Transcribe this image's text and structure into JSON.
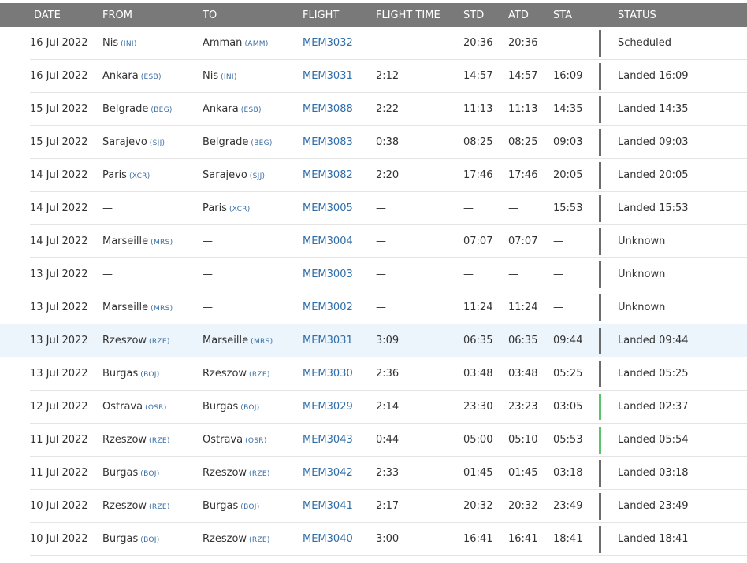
{
  "columns": {
    "date": "DATE",
    "from": "FROM",
    "to": "TO",
    "flight": "FLIGHT",
    "flight_time": "FLIGHT TIME",
    "std": "STD",
    "atd": "ATD",
    "sta": "STA",
    "status": "STATUS"
  },
  "colors": {
    "header_bg": "#797979",
    "link": "#2f6da8",
    "highlight_row": "#edf5fc",
    "status_bar_default": "#6b6b6b",
    "status_bar_ontime": "#5dc26b"
  },
  "rows": [
    {
      "date": "16 Jul 2022",
      "from": {
        "city": "Nis",
        "code": "(INI)"
      },
      "to": {
        "city": "Amman",
        "code": "(AMM)"
      },
      "flight": "MEM3032",
      "flight_time": "—",
      "std": "20:36",
      "atd": "20:36",
      "sta": "—",
      "status": "Scheduled",
      "bar": "default",
      "highlight": false
    },
    {
      "date": "16 Jul 2022",
      "from": {
        "city": "Ankara",
        "code": "(ESB)"
      },
      "to": {
        "city": "Nis",
        "code": "(INI)"
      },
      "flight": "MEM3031",
      "flight_time": "2:12",
      "std": "14:57",
      "atd": "14:57",
      "sta": "16:09",
      "status": "Landed 16:09",
      "bar": "default",
      "highlight": false
    },
    {
      "date": "15 Jul 2022",
      "from": {
        "city": "Belgrade",
        "code": "(BEG)"
      },
      "to": {
        "city": "Ankara",
        "code": "(ESB)"
      },
      "flight": "MEM3088",
      "flight_time": "2:22",
      "std": "11:13",
      "atd": "11:13",
      "sta": "14:35",
      "status": "Landed 14:35",
      "bar": "default",
      "highlight": false
    },
    {
      "date": "15 Jul 2022",
      "from": {
        "city": "Sarajevo",
        "code": "(SJJ)"
      },
      "to": {
        "city": "Belgrade",
        "code": "(BEG)"
      },
      "flight": "MEM3083",
      "flight_time": "0:38",
      "std": "08:25",
      "atd": "08:25",
      "sta": "09:03",
      "status": "Landed 09:03",
      "bar": "default",
      "highlight": false
    },
    {
      "date": "14 Jul 2022",
      "from": {
        "city": "Paris",
        "code": "(XCR)"
      },
      "to": {
        "city": "Sarajevo",
        "code": "(SJJ)"
      },
      "flight": "MEM3082",
      "flight_time": "2:20",
      "std": "17:46",
      "atd": "17:46",
      "sta": "20:05",
      "status": "Landed 20:05",
      "bar": "default",
      "highlight": false
    },
    {
      "date": "14 Jul 2022",
      "from": {
        "city": "—",
        "code": ""
      },
      "to": {
        "city": "Paris",
        "code": "(XCR)"
      },
      "flight": "MEM3005",
      "flight_time": "—",
      "std": "—",
      "atd": "—",
      "sta": "15:53",
      "status": "Landed 15:53",
      "bar": "default",
      "highlight": false
    },
    {
      "date": "14 Jul 2022",
      "from": {
        "city": "Marseille",
        "code": "(MRS)"
      },
      "to": {
        "city": "—",
        "code": ""
      },
      "flight": "MEM3004",
      "flight_time": "—",
      "std": "07:07",
      "atd": "07:07",
      "sta": "—",
      "status": "Unknown",
      "bar": "default",
      "highlight": false
    },
    {
      "date": "13 Jul 2022",
      "from": {
        "city": "—",
        "code": ""
      },
      "to": {
        "city": "—",
        "code": ""
      },
      "flight": "MEM3003",
      "flight_time": "—",
      "std": "—",
      "atd": "—",
      "sta": "—",
      "status": "Unknown",
      "bar": "default",
      "highlight": false
    },
    {
      "date": "13 Jul 2022",
      "from": {
        "city": "Marseille",
        "code": "(MRS)"
      },
      "to": {
        "city": "—",
        "code": ""
      },
      "flight": "MEM3002",
      "flight_time": "—",
      "std": "11:24",
      "atd": "11:24",
      "sta": "—",
      "status": "Unknown",
      "bar": "default",
      "highlight": false
    },
    {
      "date": "13 Jul 2022",
      "from": {
        "city": "Rzeszow",
        "code": "(RZE)"
      },
      "to": {
        "city": "Marseille",
        "code": "(MRS)"
      },
      "flight": "MEM3031",
      "flight_time": "3:09",
      "std": "06:35",
      "atd": "06:35",
      "sta": "09:44",
      "status": "Landed 09:44",
      "bar": "default",
      "highlight": true
    },
    {
      "date": "13 Jul 2022",
      "from": {
        "city": "Burgas",
        "code": "(BOJ)"
      },
      "to": {
        "city": "Rzeszow",
        "code": "(RZE)"
      },
      "flight": "MEM3030",
      "flight_time": "2:36",
      "std": "03:48",
      "atd": "03:48",
      "sta": "05:25",
      "status": "Landed 05:25",
      "bar": "default",
      "highlight": false
    },
    {
      "date": "12 Jul 2022",
      "from": {
        "city": "Ostrava",
        "code": "(OSR)"
      },
      "to": {
        "city": "Burgas",
        "code": "(BOJ)"
      },
      "flight": "MEM3029",
      "flight_time": "2:14",
      "std": "23:30",
      "atd": "23:23",
      "sta": "03:05",
      "status": "Landed 02:37",
      "bar": "ontime",
      "highlight": false
    },
    {
      "date": "11 Jul 2022",
      "from": {
        "city": "Rzeszow",
        "code": "(RZE)"
      },
      "to": {
        "city": "Ostrava",
        "code": "(OSR)"
      },
      "flight": "MEM3043",
      "flight_time": "0:44",
      "std": "05:00",
      "atd": "05:10",
      "sta": "05:53",
      "status": "Landed 05:54",
      "bar": "ontime",
      "highlight": false
    },
    {
      "date": "11 Jul 2022",
      "from": {
        "city": "Burgas",
        "code": "(BOJ)"
      },
      "to": {
        "city": "Rzeszow",
        "code": "(RZE)"
      },
      "flight": "MEM3042",
      "flight_time": "2:33",
      "std": "01:45",
      "atd": "01:45",
      "sta": "03:18",
      "status": "Landed 03:18",
      "bar": "default",
      "highlight": false
    },
    {
      "date": "10 Jul 2022",
      "from": {
        "city": "Rzeszow",
        "code": "(RZE)"
      },
      "to": {
        "city": "Burgas",
        "code": "(BOJ)"
      },
      "flight": "MEM3041",
      "flight_time": "2:17",
      "std": "20:32",
      "atd": "20:32",
      "sta": "23:49",
      "status": "Landed 23:49",
      "bar": "default",
      "highlight": false
    },
    {
      "date": "10 Jul 2022",
      "from": {
        "city": "Burgas",
        "code": "(BOJ)"
      },
      "to": {
        "city": "Rzeszow",
        "code": "(RZE)"
      },
      "flight": "MEM3040",
      "flight_time": "3:00",
      "std": "16:41",
      "atd": "16:41",
      "sta": "18:41",
      "status": "Landed 18:41",
      "bar": "default",
      "highlight": false
    }
  ]
}
